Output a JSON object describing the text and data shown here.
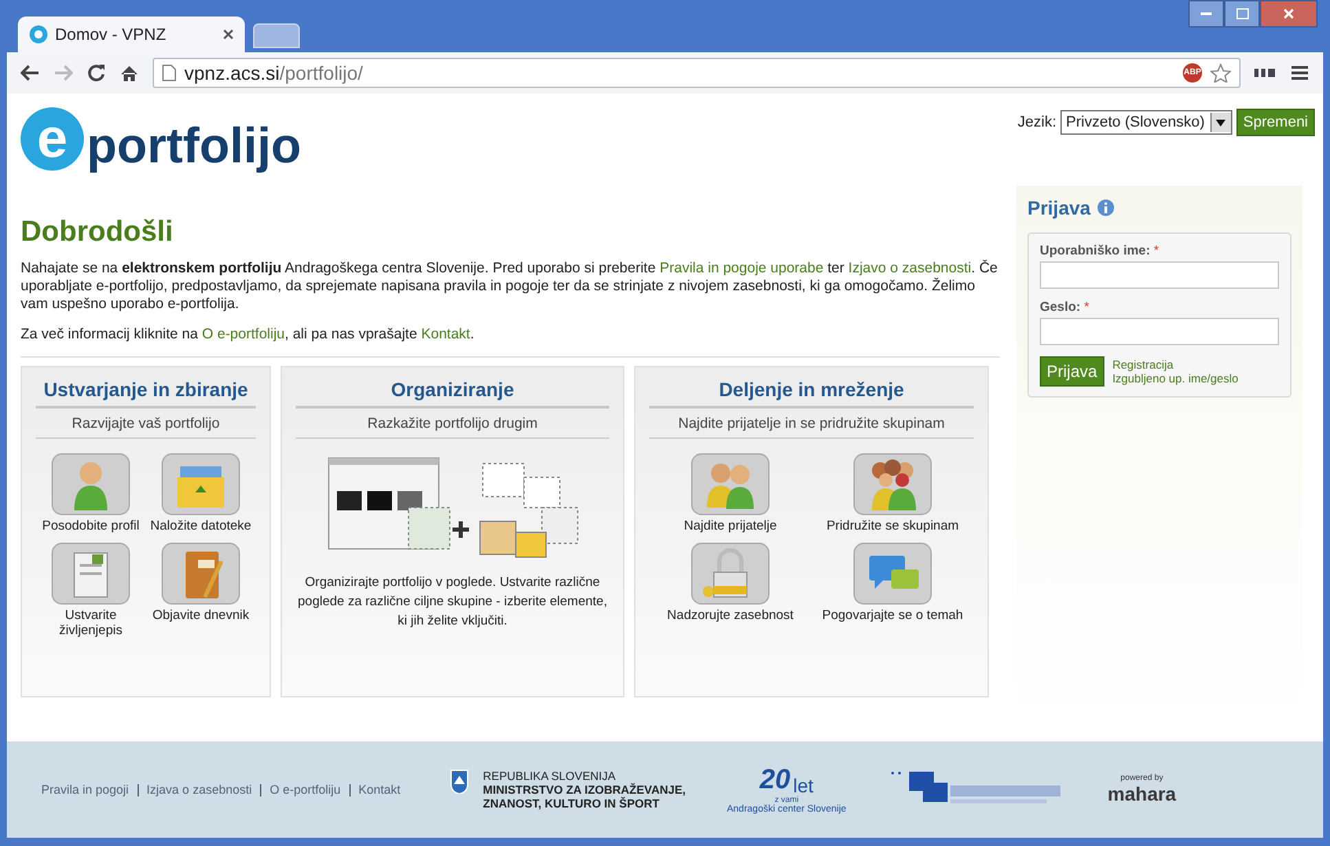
{
  "browser": {
    "tab_title": "Domov - VPNZ",
    "url_host": "vpnz.acs.si",
    "url_path": "/portfolijo/",
    "extension_badge": "ABP"
  },
  "header": {
    "logo_letter": "e",
    "logo_word": "portfolijo",
    "language_label": "Jezik:",
    "language_value": "Privzeto (Slovensko)",
    "language_button": "Spremeni"
  },
  "welcome": {
    "title": "Dobrodošli",
    "intro": [
      {
        "kind": "plain",
        "text": "Nahajate se na "
      },
      {
        "kind": "bold",
        "text": "elektronskem portfoliju"
      },
      {
        "kind": "plain",
        "text": " Andragoškega centra Slovenije. Pred uporabo si preberite "
      },
      {
        "kind": "link",
        "text": "Pravila in pogoje uporabe"
      },
      {
        "kind": "plain",
        "text": " ter "
      },
      {
        "kind": "link",
        "text": "Izjavo o zasebnosti"
      },
      {
        "kind": "plain",
        "text": ". Če uporabljate e-portfolijo, predpostavljamo, da sprejemate napisana pravila in pogoje ter da se strinjate z nivojem zasebnosti, ki ga omogočamo. Želimo vam uspešno uporabo e-portfolija."
      }
    ],
    "more": [
      {
        "kind": "plain",
        "text": "Za več informacij kliknite na "
      },
      {
        "kind": "link",
        "text": "O e-portfoliju"
      },
      {
        "kind": "plain",
        "text": ", ali pa nas vprašajte "
      },
      {
        "kind": "link",
        "text": "Kontakt"
      },
      {
        "kind": "plain",
        "text": "."
      }
    ]
  },
  "panels": [
    {
      "title": "Ustvarjanje in zbiranje",
      "subtitle": "Razvijajte vaš portfolijo",
      "items": [
        {
          "kind": "person",
          "label": "Posodobite profil"
        },
        {
          "kind": "folder",
          "label": "Naložite datoteke"
        },
        {
          "kind": "document",
          "label": "Ustvarite življenjepis"
        },
        {
          "kind": "notebook",
          "label": "Objavite dnevnik"
        }
      ]
    },
    {
      "title": "Organiziranje",
      "subtitle": "Razkažite portfolijo drugim",
      "description": "Organizirajte portfolijo v poglede. Ustvarite različne poglede za različne ciljne skupine - izberite elemente, ki jih želite vključiti."
    },
    {
      "title": "Deljenje in mreženje",
      "subtitle": "Najdite prijatelje in se pridružite skupinam",
      "items": [
        {
          "kind": "friends",
          "label": "Najdite prijatelje"
        },
        {
          "kind": "group",
          "label": "Pridružite se skupinam"
        },
        {
          "kind": "lock",
          "label": "Nadzorujte zasebnost"
        },
        {
          "kind": "chat",
          "label": "Pogovarjajte se o temah"
        }
      ]
    }
  ],
  "login": {
    "title": "Prijava",
    "username_label": "Uporabniško ime:",
    "password_label": "Geslo:",
    "required_mark": "*",
    "button": "Prijava",
    "links": [
      "Registracija",
      "Izgubljeno up. ime/geslo"
    ]
  },
  "footer": {
    "links": [
      "Pravila in pogoji",
      "Izjava o zasebnosti",
      "O e-portfoliju",
      "Kontakt"
    ],
    "ministry": [
      "REPUBLIKA SLOVENIJA",
      "MINISTRSTVO ZA IZOBRAŽEVANJE,",
      "ZNANOST, KULTURO IN ŠPORT"
    ],
    "anniversary": {
      "number": "20",
      "word": "let",
      "sub": "z vami",
      "org": "Andragoški center Slovenije"
    },
    "powered": {
      "top": "powered by",
      "name": "mahara"
    }
  }
}
